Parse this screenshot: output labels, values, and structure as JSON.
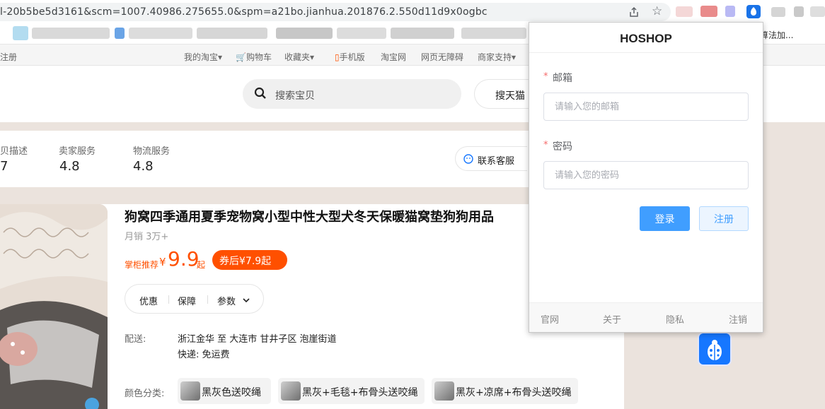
{
  "browser": {
    "url": "l-20b5be5d3161&scm=1007.40986.275655.0&spm=a21bo.jianhua.201876.2.550d11d9x0ogbc",
    "bookmark_tail": "算法加..."
  },
  "topnav": {
    "register": "注册",
    "my_taobao": "我的淘宝",
    "cart": "购物车",
    "favorites": "收藏夹",
    "mobile": "手机版",
    "taobao": "淘宝网",
    "accessible": "网页无障碍",
    "seller_support": "商家支持"
  },
  "search": {
    "placeholder": "搜索宝贝",
    "button": "搜天猫"
  },
  "shop_scores": {
    "desc_label": "贝描述",
    "desc_value": "7",
    "seller_label": "卖家服务",
    "seller_value": "4.8",
    "logistics_label": "物流服务",
    "logistics_value": "4.8",
    "contact": "联系客服"
  },
  "product": {
    "title": "狗窝四季通用夏季宠物窝小型中性大型犬冬天保暖猫窝垫狗狗用品",
    "monthly_sales": "月销 3万+",
    "price_label": "掌柜推荐",
    "currency": "¥",
    "price": "9.9",
    "price_suffix": "起",
    "coupon": "券后¥7.9起",
    "tabs": [
      "优惠",
      "保障",
      "参数"
    ],
    "delivery_label": "配送:",
    "delivery_route": "浙江金华 至 大连市 甘井子区 泡崖街道",
    "shipping": "快递: 免运费",
    "color_label": "颜色分类:",
    "colors": [
      "黑灰色送咬绳",
      "黑灰+毛毯+布骨头送咬绳",
      "黑灰+凉席+布骨头送咬绳"
    ]
  },
  "popup": {
    "title": "HOSHOP",
    "required_mark": "*",
    "email_label": "邮箱",
    "email_placeholder": "请输入您的邮箱",
    "password_label": "密码",
    "password_placeholder": "请输入您的密码",
    "login": "登录",
    "register": "注册",
    "footer": [
      "官网",
      "关于",
      "隐私",
      "注销"
    ]
  },
  "colors": {
    "accent_orange": "#ff5000",
    "primary_blue": "#409eff",
    "band_beige": "#ebe3dd"
  }
}
